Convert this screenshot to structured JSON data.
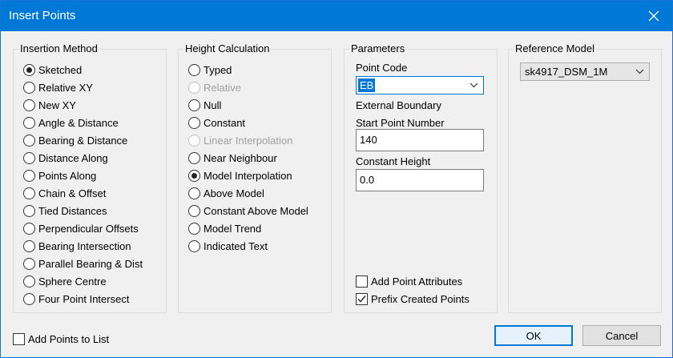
{
  "window": {
    "title": "Insert Points"
  },
  "insertion_method": {
    "label": "Insertion Method",
    "items": [
      {
        "label": "Sketched",
        "checked": true
      },
      {
        "label": "Relative XY"
      },
      {
        "label": "New XY"
      },
      {
        "label": "Angle & Distance"
      },
      {
        "label": "Bearing & Distance"
      },
      {
        "label": "Distance Along"
      },
      {
        "label": "Points Along"
      },
      {
        "label": "Chain & Offset"
      },
      {
        "label": "Tied Distances"
      },
      {
        "label": "Perpendicular Offsets"
      },
      {
        "label": "Bearing Intersection"
      },
      {
        "label": "Parallel Bearing & Dist"
      },
      {
        "label": "Sphere Centre"
      },
      {
        "label": "Four Point Intersect"
      }
    ]
  },
  "height_calculation": {
    "label": "Height Calculation",
    "items": [
      {
        "label": "Typed"
      },
      {
        "label": "Relative",
        "disabled": true
      },
      {
        "label": "Null"
      },
      {
        "label": "Constant"
      },
      {
        "label": "Linear Interpolation",
        "disabled": true
      },
      {
        "label": "Near Neighbour"
      },
      {
        "label": "Model Interpolation",
        "checked": true
      },
      {
        "label": "Above Model"
      },
      {
        "label": "Constant Above Model"
      },
      {
        "label": "Model Trend"
      },
      {
        "label": "Indicated Text"
      }
    ]
  },
  "parameters": {
    "label": "Parameters",
    "point_code_label": "Point Code",
    "point_code_value": "EB",
    "point_code_description": "External Boundary",
    "start_point_label": "Start Point Number",
    "start_point_value": "140",
    "constant_height_label": "Constant Height",
    "constant_height_value": "0.0",
    "add_attributes_label": "Add Point Attributes",
    "add_attributes_checked": false,
    "prefix_label": "Prefix Created Points",
    "prefix_checked": true
  },
  "reference_model": {
    "label": "Reference Model",
    "value": "sk4917_DSM_1M"
  },
  "add_to_list": {
    "label": "Add Points to List",
    "checked": false
  },
  "buttons": {
    "ok": "OK",
    "cancel": "Cancel"
  },
  "colors": {
    "accent": "#0078d7",
    "disabled_text": "#a0a0a0"
  }
}
